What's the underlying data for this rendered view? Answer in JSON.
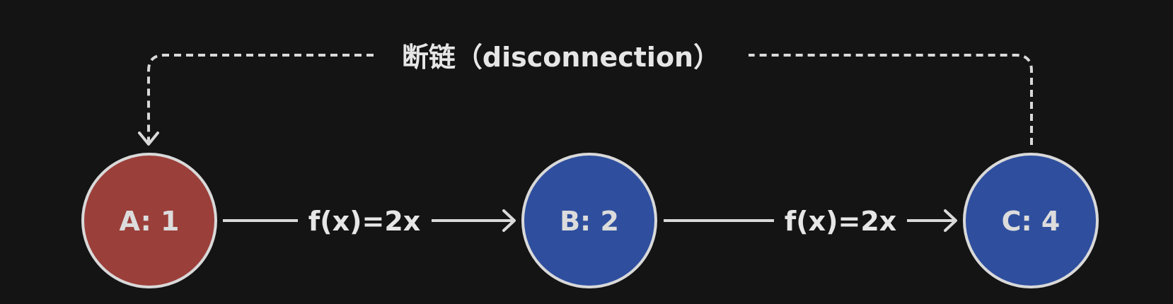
{
  "diagram": {
    "nodes": [
      {
        "id": "A",
        "label": "A: 1",
        "color": "#9b3f3a"
      },
      {
        "id": "B",
        "label": "B: 2",
        "color": "#2f4f9e"
      },
      {
        "id": "C",
        "label": "C: 4",
        "color": "#2f4f9e"
      }
    ],
    "edges": [
      {
        "from": "A",
        "to": "B",
        "label": "f(x)=2x"
      },
      {
        "from": "B",
        "to": "C",
        "label": "f(x)=2x"
      }
    ],
    "disconnection": {
      "from": "C",
      "to": "A",
      "label": "断链（disconnection）",
      "style": "dashed"
    },
    "colors": {
      "background": "#141414",
      "stroke": "#d9d9d9",
      "text": "#e6e6e6"
    }
  }
}
